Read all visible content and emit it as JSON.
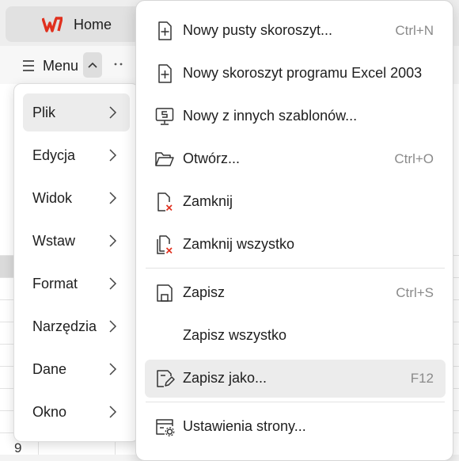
{
  "tabbar": {
    "home_label": "Home"
  },
  "toolbar": {
    "menu_label": "Menu"
  },
  "sheet": {
    "row_number": "9"
  },
  "left_menu": {
    "items": [
      {
        "label": "Plik",
        "active": true
      },
      {
        "label": "Edycja"
      },
      {
        "label": "Widok"
      },
      {
        "label": "Wstaw"
      },
      {
        "label": "Format"
      },
      {
        "label": "Narzędzia"
      },
      {
        "label": "Dane"
      },
      {
        "label": "Okno"
      }
    ]
  },
  "file_menu": {
    "items": [
      {
        "label": "Nowy pusty skoroszyt...",
        "shortcut": "Ctrl+N",
        "icon": "new-file-icon"
      },
      {
        "label": "Nowy skoroszyt programu Excel 2003",
        "shortcut": "",
        "icon": "new-file-icon"
      },
      {
        "label": "Nowy z innych szablonów...",
        "shortcut": "",
        "icon": "template-icon"
      },
      {
        "label": "Otwórz...",
        "shortcut": "Ctrl+O",
        "icon": "folder-open-icon"
      },
      {
        "label": "Zamknij",
        "shortcut": "",
        "icon": "close-file-icon"
      },
      {
        "label": "Zamknij wszystko",
        "shortcut": "",
        "icon": "close-all-files-icon"
      },
      {
        "label": "Zapisz",
        "shortcut": "Ctrl+S",
        "icon": "save-icon"
      },
      {
        "label": "Zapisz wszystko",
        "shortcut": "",
        "icon": ""
      },
      {
        "label": "Zapisz jako...",
        "shortcut": "F12",
        "icon": "save-as-icon"
      },
      {
        "label": "Ustawienia strony...",
        "shortcut": "",
        "icon": "page-setup-icon"
      }
    ]
  },
  "colors": {
    "accent_red": "#e0301e",
    "hover_bg": "#ececec"
  }
}
